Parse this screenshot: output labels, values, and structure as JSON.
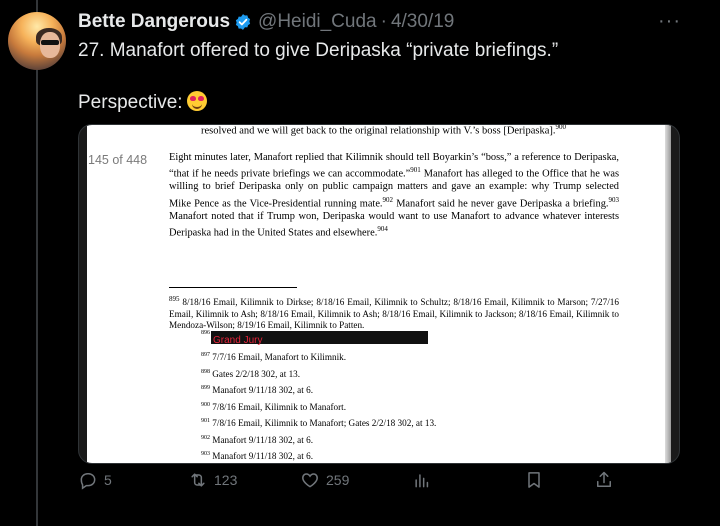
{
  "tweet": {
    "author_name": "Bette Dangerous",
    "handle": "@Heidi_Cuda",
    "date": "4/30/19",
    "separator": "·",
    "more": "···",
    "text_line1": "27. Manafort offered to give Deripaska “private briefings.”",
    "text_line2": "Perspective:"
  },
  "document": {
    "page_indicator": "145 of 448",
    "top_line": "resolved and we will get back to the original relationship with V.’s boss [Deripaska].",
    "top_line_sup": "900",
    "paragraph": [
      {
        "t": "Eight minutes later, Manafort replied that Kilimnik should tell Boyarkin’s “boss,” a reference to Deripaska, “that if he needs private briefings we can accommodate.”"
      },
      {
        "sup": "901"
      },
      {
        "t": " Manafort has alleged to the Office that he was willing to brief Deripaska only on public campaign matters and gave an example: why Trump selected Mike Pence as the Vice-Presidential running mate."
      },
      {
        "sup": "902"
      },
      {
        "t": " Manafort said he never gave Deripaska a briefing."
      },
      {
        "sup": "903"
      },
      {
        "t": " Manafort noted that if Trump won, Deripaska would want to use Manafort to advance whatever interests Deripaska had in the United States and elsewhere."
      },
      {
        "sup": "904"
      }
    ],
    "footnote_895_num": "895",
    "footnote_895": "8/18/16 Email, Kilimnik to Dirkse; 8/18/16 Email, Kilimnik to Schultz; 8/18/16 Email, Kilimnik to Marson; 7/27/16 Email, Kilimnik to Ash; 8/18/16 Email, Kilimnik to Ash; 8/18/16 Email, Kilimnik to Jackson; 8/18/16 Email, Kilimnik to Mendoza-Wilson; 8/19/16 Email, Kilimnik to Patten.",
    "redaction_num": "896",
    "redaction_label": "Grand Jury",
    "footnotes": [
      {
        "num": "897",
        "text": "7/7/16 Email, Manafort to Kilimnik."
      },
      {
        "num": "898",
        "text": "Gates 2/2/18 302, at 13."
      },
      {
        "num": "899",
        "text": "Manafort 9/11/18 302, at 6."
      },
      {
        "num": "900",
        "text": "7/8/16 Email, Kilimnik to Manafort."
      },
      {
        "num": "901",
        "text": "7/8/16 Email, Kilimnik to Manafort; Gates 2/2/18 302, at 13."
      },
      {
        "num": "902",
        "text": "Manafort 9/11/18 302, at 6."
      },
      {
        "num": "903",
        "text": "Manafort 9/11/18 302, at 6."
      }
    ]
  },
  "actions": {
    "replies": "5",
    "retweets": "123",
    "likes": "259"
  },
  "colors": {
    "background": "#000000",
    "muted": "#71767b",
    "verified": "#1d9bf0",
    "redaction_text": "#e8233a"
  }
}
